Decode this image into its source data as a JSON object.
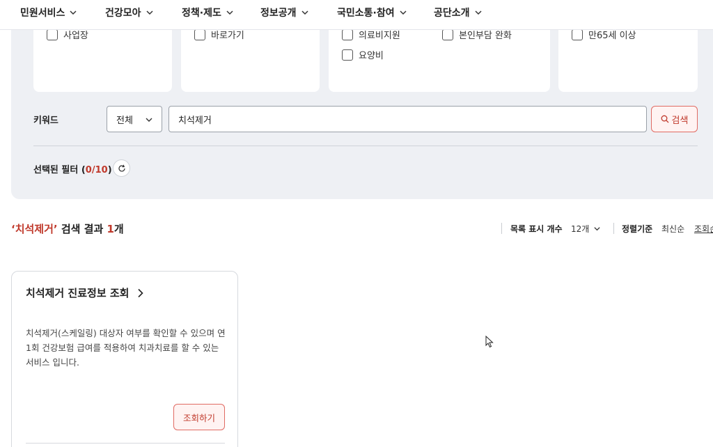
{
  "nav": {
    "items": [
      {
        "label": "민원서비스"
      },
      {
        "label": "건강모아"
      },
      {
        "label": "정책·제도"
      },
      {
        "label": "정보공개"
      },
      {
        "label": "국민소통·참여"
      },
      {
        "label": "공단소개"
      }
    ],
    "chevron_icon": "chevron-down-icon"
  },
  "filters": {
    "cards": [
      {
        "options": [
          "사업장"
        ]
      },
      {
        "options": [
          "바로가기"
        ]
      },
      {
        "options": [
          "의료비지원",
          "본인부담 완화",
          "요양비"
        ]
      },
      {
        "options": [
          "만65세 이상"
        ]
      }
    ],
    "keyword": {
      "label": "키워드",
      "scope_value": "전체",
      "input_value": "치석제거",
      "search_label": "검색"
    },
    "selected": {
      "prefix": "선택된 필터 (",
      "count": "0/10",
      "suffix": ")"
    }
  },
  "results": {
    "title_quote_open": "‘",
    "title_keyword": "치석제거",
    "title_quote_close": "’",
    "title_middle": " 검색 결과 ",
    "count": "1",
    "title_unit": "개",
    "list_count_label": "목록 표시 개수",
    "list_count_value": "12개",
    "sort_label": "정렬기준",
    "sort_newest": "최신순",
    "sort_views": "조회순",
    "cards": [
      {
        "title": "치석제거 진료정보 조회",
        "description": "치석제거(스케일링) 대상자 여부를 확인할 수 있으며 연 1회 건강보험 급여를 적용하여 치과치료를 할 수 있는 서비스 입니다.",
        "button": "조회하기"
      }
    ]
  },
  "colors": {
    "accent": "#c0392b",
    "panel_bg": "#eef0f4",
    "button_bg": "#fff3f2"
  }
}
